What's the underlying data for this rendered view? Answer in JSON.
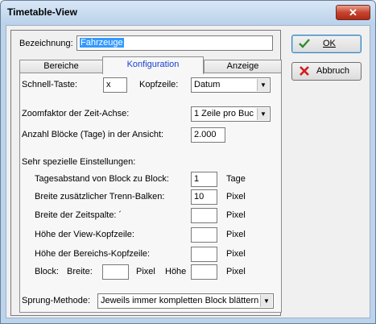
{
  "window": {
    "title": "Timetable-View",
    "close_glyph": "✕"
  },
  "form": {
    "bezeichnung_label": "Bezeichnung:",
    "bezeichnung_value": "Fahrzeuge"
  },
  "tabs": [
    {
      "label": "Bereiche",
      "active": false
    },
    {
      "label": "Konfiguration",
      "active": true
    },
    {
      "label": "Anzeige",
      "active": false
    }
  ],
  "config": {
    "schnell_taste_label": "Schnell-Taste:",
    "schnell_taste_value": "x",
    "kopfzeile_label": "Kopfzeile:",
    "kopfzeile_value": "Datum",
    "zoom_label": "Zoomfaktor der Zeit-Achse:",
    "zoom_value": "1 Zeile pro Buc",
    "anzahl_label": "Anzahl Blöcke (Tage) in der Ansicht:",
    "anzahl_value": "2.000",
    "spezial_heading": "Sehr spezielle Einstellungen:",
    "tagesabstand_label": "Tagesabstand von Block zu Block:",
    "tagesabstand_value": "1",
    "tagesabstand_unit": "Tage",
    "trenn_label": "Breite zusätzlicher Trenn-Balken:",
    "trenn_value": "10",
    "trenn_unit": "Pixel",
    "zeitspalte_label": "Breite der Zeitspalte: ´",
    "zeitspalte_value": "",
    "zeitspalte_unit": "Pixel",
    "viewkopf_label": "Höhe der View-Kopfzeile:",
    "viewkopf_value": "",
    "viewkopf_unit": "Pixel",
    "bereichkopf_label": "Höhe der Bereichs-Kopfzeile:",
    "bereichkopf_value": "",
    "bereichkopf_unit": "Pixel",
    "block_label": "Block:",
    "breite_label": "Breite:",
    "breite_value": "",
    "breite_unit": "Pixel",
    "hoehe_label": "Höhe",
    "hoehe_value": "",
    "hoehe_unit": "Pixel",
    "sprung_label": "Sprung-Methode:",
    "sprung_value": "Jeweils immer kompletten Block blättern"
  },
  "buttons": {
    "ok_label": "OK",
    "abbruch_label": "Abbruch"
  },
  "colors": {
    "accent": "#3399ff",
    "active_tab_text": "#1a3fd1",
    "ok_check": "#2e8b2e",
    "cancel_x": "#d21f1f"
  }
}
